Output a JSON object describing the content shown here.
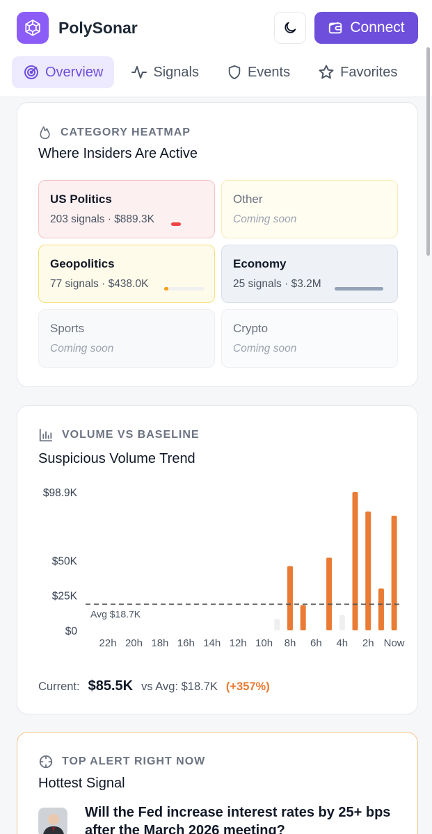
{
  "app": {
    "name": "PolySonar",
    "connect_label": "Connect"
  },
  "tabs": [
    {
      "label": "Overview",
      "icon": "radar-icon",
      "active": true
    },
    {
      "label": "Signals",
      "icon": "activity-icon",
      "active": false
    },
    {
      "label": "Events",
      "icon": "shield-icon",
      "active": false
    },
    {
      "label": "Favorites",
      "icon": "star-icon",
      "active": false
    }
  ],
  "heatmap": {
    "eyebrow": "CATEGORY HEATMAP",
    "title": "Where Insiders Are Active",
    "categories": [
      {
        "name": "US Politics",
        "meta": "203 signals · $889.3K",
        "level": 0.05,
        "bar_color": "#ef4444",
        "status": "active"
      },
      {
        "name": "Other",
        "meta": "Coming soon",
        "status": "soon"
      },
      {
        "name": "Geopolitics",
        "meta": "77 signals · $438.0K",
        "level": 0.03,
        "bar_color": "#f59e0b",
        "status": "active"
      },
      {
        "name": "Economy",
        "meta": "25 signals · $3.2M",
        "level": 1.0,
        "bar_color": "#94a3b8",
        "status": "active"
      },
      {
        "name": "Sports",
        "meta": "Coming soon",
        "status": "soon"
      },
      {
        "name": "Crypto",
        "meta": "Coming soon",
        "status": "soon"
      }
    ]
  },
  "volume": {
    "eyebrow": "VOLUME VS BASELINE",
    "title": "Suspicious Volume Trend",
    "current_label": "Current:",
    "current_value": "$85.5K",
    "avg_text": "vs Avg: $18.7K",
    "pct_text": "(+357%)"
  },
  "chart_data": {
    "type": "bar",
    "categories": [
      "23h",
      "22h",
      "21h",
      "20h",
      "19h",
      "18h",
      "17h",
      "16h",
      "15h",
      "14h",
      "13h",
      "12h",
      "11h",
      "10h",
      "9h",
      "8h",
      "7h",
      "6h",
      "5h",
      "4h",
      "3h",
      "2h",
      "1h",
      "Now"
    ],
    "x_tick_labels": [
      "22h",
      "20h",
      "18h",
      "16h",
      "14h",
      "12h",
      "10h",
      "8h",
      "6h",
      "4h",
      "2h",
      "Now"
    ],
    "values": [
      0,
      0,
      0,
      0,
      0,
      0,
      0,
      0,
      0,
      0,
      0,
      0,
      0,
      0,
      8000,
      46000,
      18000,
      0,
      52000,
      11000,
      98900,
      85000,
      30000,
      82000
    ],
    "highlighted": [
      false,
      false,
      false,
      false,
      false,
      false,
      false,
      false,
      false,
      false,
      false,
      false,
      false,
      false,
      false,
      true,
      true,
      false,
      true,
      false,
      true,
      true,
      true,
      true
    ],
    "y_ticks": [
      "$98.9K",
      "$50K",
      "$25K",
      "$0"
    ],
    "y_tick_values": [
      98900,
      50000,
      25000,
      0
    ],
    "ylim": [
      0,
      98900
    ],
    "baseline": {
      "value": 18700,
      "label": "Avg $18.7K"
    },
    "colors": {
      "highlight": "#ea7b34",
      "normal": "#efefef",
      "baseline": "#555555"
    }
  },
  "alert": {
    "eyebrow": "TOP ALERT RIGHT NOW",
    "title": "Hottest Signal",
    "question": "Will the Fed increase interest rates by 25+ bps after the March 2026 meeting?"
  }
}
